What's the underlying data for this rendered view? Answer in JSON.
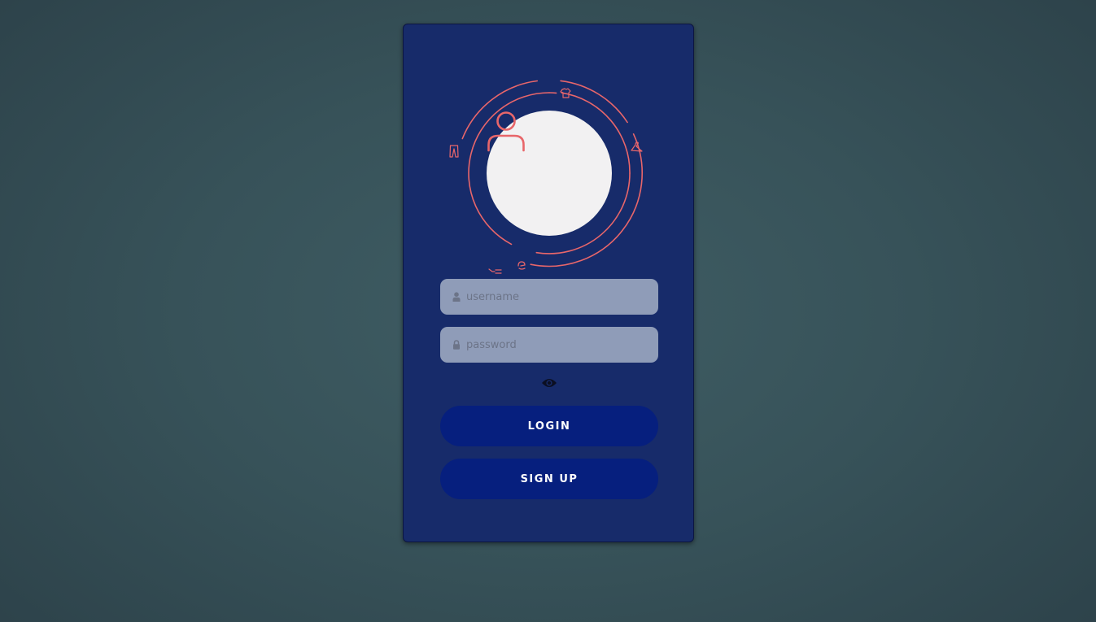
{
  "login_card": {
    "avatar": {
      "icon": "user-icon",
      "orbit_icons": [
        "shirt-icon",
        "hanger-icon",
        "sock-icon",
        "pants-icon",
        "tie-icon"
      ]
    },
    "username": {
      "placeholder": "username",
      "value": "",
      "icon": "user-small-icon"
    },
    "password": {
      "placeholder": "password",
      "value": "",
      "icon": "lock-icon"
    },
    "show_password_icon": "eye-icon",
    "buttons": {
      "login_label": "LOGIN",
      "signup_label": "SIGN UP"
    }
  },
  "colors": {
    "page_background": "#375259",
    "card_background": "#172b6a",
    "accent": "#e8666a",
    "avatar_fill": "#f2f1f2",
    "input_background": "#8f9cb8",
    "button_background": "#061f7e",
    "button_text": "#ffffff"
  }
}
